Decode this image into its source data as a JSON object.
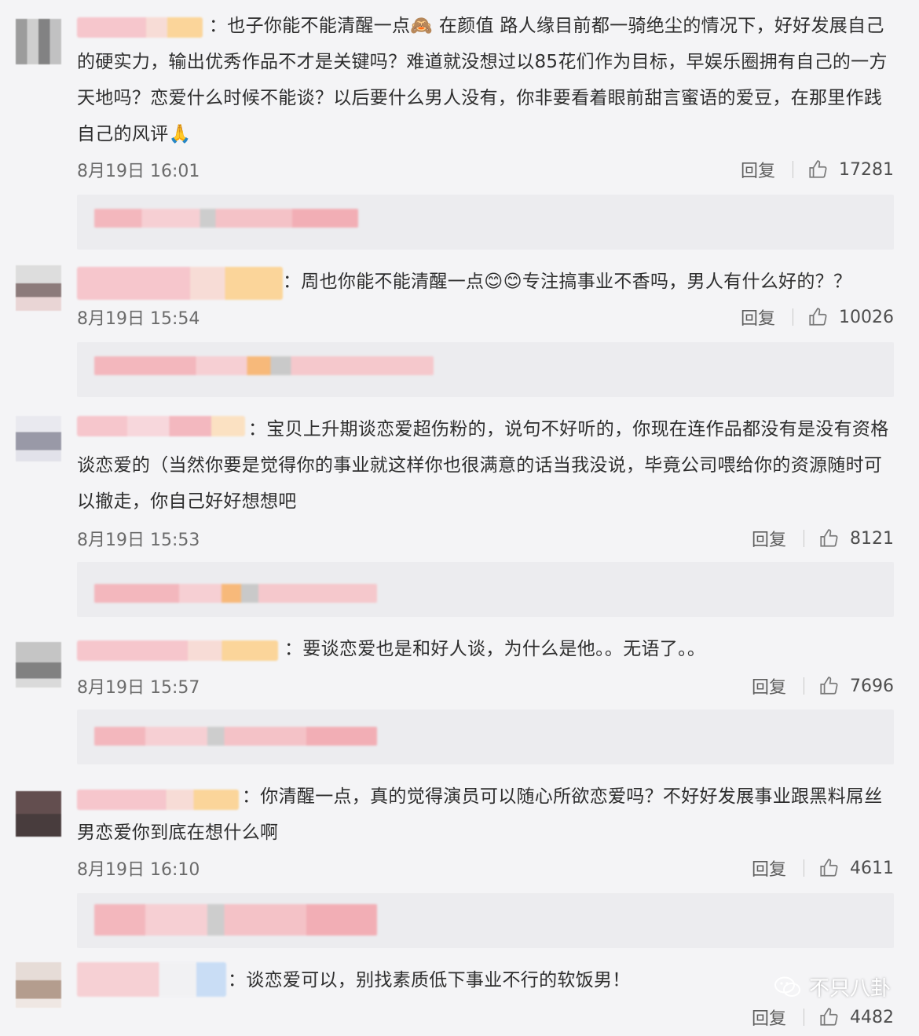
{
  "comments": [
    {
      "text": "：也子你能不能清醒一点🙈 在颜值 路人缘目前都一骑绝尘的情况下，好好发展自己的硬实力，输出优秀作品不才是关键吗？难道就没想过以85花们作为目标，早娱乐圈拥有自己的一方天地吗？恋爱什么时候不能谈？以后要什么男人没有，你非要看着眼前甜言蜜语的爱豆，在那里作践自己的风评🙏",
      "time": "8月19日 16:01",
      "reply": "回复",
      "likes": "17281"
    },
    {
      "text": "：周也你能不能清醒一点😊😊专注搞事业不香吗，男人有什么好的？？",
      "time": "8月19日 15:54",
      "reply": "回复",
      "likes": "10026"
    },
    {
      "text": "：宝贝上升期谈恋爱超伤粉的，说句不好听的，你现在连作品都没有是没有资格谈恋爱的（当然你要是觉得你的事业就这样你也很满意的话当我没说，毕竟公司喂给你的资源随时可以撤走，你自己好好想想吧",
      "time": "8月19日 15:53",
      "reply": "回复",
      "likes": "8121"
    },
    {
      "text": "：要谈恋爱也是和好人谈，为什么是他。。无语了。。",
      "time": "8月19日 15:57",
      "reply": "回复",
      "likes": "7696"
    },
    {
      "text": "：你清醒一点，真的觉得演员可以随心所欲恋爱吗？不好好发展事业跟黑料屌丝男恋爱你到底在想什么啊",
      "time": "8月19日 16:10",
      "reply": "回复",
      "likes": "4611"
    },
    {
      "text": "：谈恋爱可以，别找素质低下事业不行的软饭男！",
      "time": "",
      "reply": "回复",
      "likes": "4482"
    }
  ],
  "watermark": {
    "label": "不只八卦",
    "icon": "wechat-icon"
  },
  "colors": {
    "background": "#f4f4f6",
    "reply_box": "#ececef",
    "text": "#2e2e2e",
    "meta": "#6b6b6b"
  }
}
